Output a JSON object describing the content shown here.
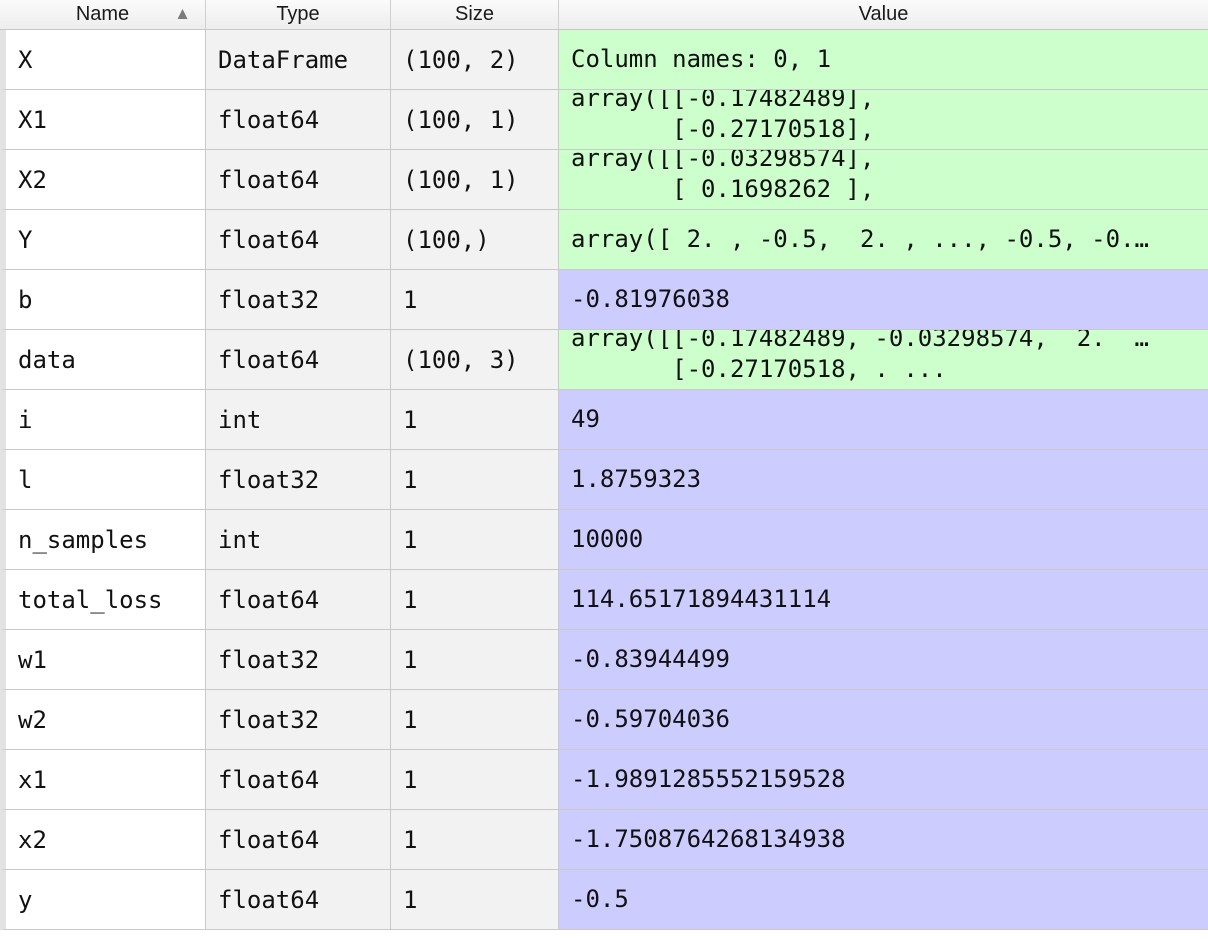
{
  "header": {
    "name": "Name",
    "type": "Type",
    "size": "Size",
    "value": "Value",
    "sort_indicator": "▲"
  },
  "colors": {
    "array_value_bg": "#ccffcc",
    "scalar_value_bg": "#ccccff",
    "type_size_bg": "#f2f2f2"
  },
  "rows": [
    {
      "name": "X",
      "type": "DataFrame",
      "size": "(100, 2)",
      "kind": "array",
      "value": "Column names: 0, 1"
    },
    {
      "name": "X1",
      "type": "float64",
      "size": "(100, 1)",
      "kind": "array",
      "value": "array([[-0.17482489],\n       [-0.27170518],"
    },
    {
      "name": "X2",
      "type": "float64",
      "size": "(100, 1)",
      "kind": "array",
      "value": "array([[-0.03298574],\n       [ 0.1698262 ],"
    },
    {
      "name": "Y",
      "type": "float64",
      "size": "(100,)",
      "kind": "array",
      "value": "array([ 2. , -0.5,  2. , ..., -0.5, -0.…"
    },
    {
      "name": "b",
      "type": "float32",
      "size": "1",
      "kind": "scalar",
      "value": "-0.81976038"
    },
    {
      "name": "data",
      "type": "float64",
      "size": "(100, 3)",
      "kind": "array",
      "value": "array([[-0.17482489, -0.03298574,  2.  …\n       [-0.27170518, . ..."
    },
    {
      "name": "i",
      "type": "int",
      "size": "1",
      "kind": "scalar",
      "value": "49"
    },
    {
      "name": "l",
      "type": "float32",
      "size": "1",
      "kind": "scalar",
      "value": "1.8759323"
    },
    {
      "name": "n_samples",
      "type": "int",
      "size": "1",
      "kind": "scalar",
      "value": "10000"
    },
    {
      "name": "total_loss",
      "type": "float64",
      "size": "1",
      "kind": "scalar",
      "value": "114.65171894431114"
    },
    {
      "name": "w1",
      "type": "float32",
      "size": "1",
      "kind": "scalar",
      "value": "-0.83944499"
    },
    {
      "name": "w2",
      "type": "float32",
      "size": "1",
      "kind": "scalar",
      "value": "-0.59704036"
    },
    {
      "name": "x1",
      "type": "float64",
      "size": "1",
      "kind": "scalar",
      "value": "-1.9891285552159528"
    },
    {
      "name": "x2",
      "type": "float64",
      "size": "1",
      "kind": "scalar",
      "value": "-1.7508764268134938"
    },
    {
      "name": "y",
      "type": "float64",
      "size": "1",
      "kind": "scalar",
      "value": "-0.5"
    }
  ]
}
